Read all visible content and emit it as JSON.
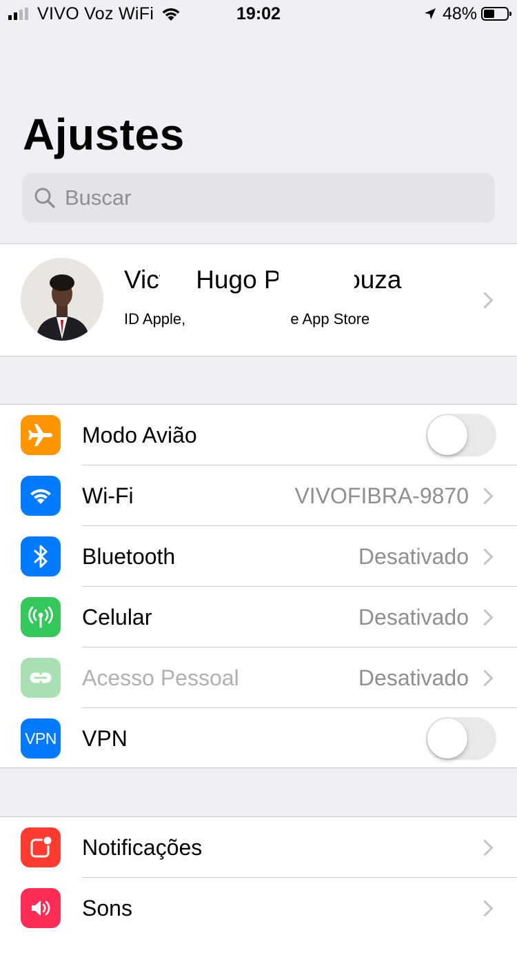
{
  "status_bar": {
    "carrier": "VIVO Voz WiFi",
    "time": "19:02",
    "battery_percent": "48%",
    "battery_level": 0.48,
    "icons": [
      "signal-icon",
      "wifi-icon",
      "location-arrow-icon",
      "battery-icon"
    ]
  },
  "page": {
    "title": "Ajustes",
    "search_placeholder": "Buscar"
  },
  "profile": {
    "name": "Victor Hugo Pinto Souza",
    "subtitle": "ID Apple, iCloud, iTunes e App Store"
  },
  "group1": [
    {
      "icon": "airplane-icon",
      "color": "#ff9500",
      "label": "Modo Avião",
      "toggle": false
    },
    {
      "icon": "wifi-icon",
      "color": "#007aff",
      "label": "Wi-Fi",
      "value": "VIVOFIBRA-9870"
    },
    {
      "icon": "bluetooth-icon",
      "color": "#007aff",
      "label": "Bluetooth",
      "value": "Desativado"
    },
    {
      "icon": "cellular-icon",
      "color": "#34c759",
      "label": "Celular",
      "value": "Desativado"
    },
    {
      "icon": "hotspot-icon",
      "color": "#a8e0b3",
      "label": "Acesso Pessoal",
      "value": "Desativado",
      "disabled": true
    },
    {
      "icon": "vpn-icon",
      "color": "#007aff",
      "label": "VPN",
      "icon_text": "VPN",
      "toggle": false
    }
  ],
  "group2": [
    {
      "icon": "notifications-icon",
      "color": "#ff3b30",
      "label": "Notificações"
    },
    {
      "icon": "sounds-icon",
      "color": "#ff2d55",
      "label": "Sons"
    }
  ]
}
